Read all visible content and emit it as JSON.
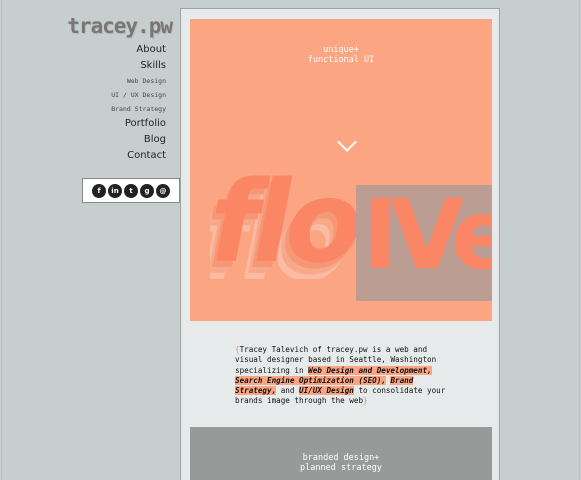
{
  "site": {
    "logo": "tracey.pw"
  },
  "nav": {
    "about": "About",
    "skills": "Skills",
    "web_design": "Web Design",
    "ui_ux_design": "UI / UX Design",
    "brand_strategy": "Brand Strategy",
    "portfolio": "Portfolio",
    "blog": "Blog",
    "contact": "Contact"
  },
  "social": [
    {
      "icon": "facebook-icon",
      "glyph": "f"
    },
    {
      "icon": "linkedin-icon",
      "glyph": "in"
    },
    {
      "icon": "twitter-icon",
      "glyph": "t"
    },
    {
      "icon": "github-icon",
      "glyph": "g"
    },
    {
      "icon": "email-icon",
      "glyph": "@"
    }
  ],
  "hero": {
    "line1": "unique+",
    "line2": "functional UI",
    "word_left": "flo",
    "word_right": "IVe"
  },
  "bio": {
    "brace_open": "{",
    "intro": "Tracey Talevich of tracey.pw is a web and visual designer based in Seattle, Washington specializing in ",
    "skill1": "Web Design and Development, Search Engine Optimization (SEO),",
    "sep1": " ",
    "skill2": "Brand Strategy,",
    "sep2": " and ",
    "skill3": "UI/UX Design",
    "outro": " to consolidate your brands image through the web",
    "brace_close": "}"
  },
  "band": {
    "line1": "branded design+",
    "line2": "planned strategy"
  },
  "colors": {
    "accent": "#fca583",
    "accent_dark": "#fa8666",
    "background": "#c7cfce",
    "panel": "#e6eaea",
    "band": "#979a99"
  }
}
